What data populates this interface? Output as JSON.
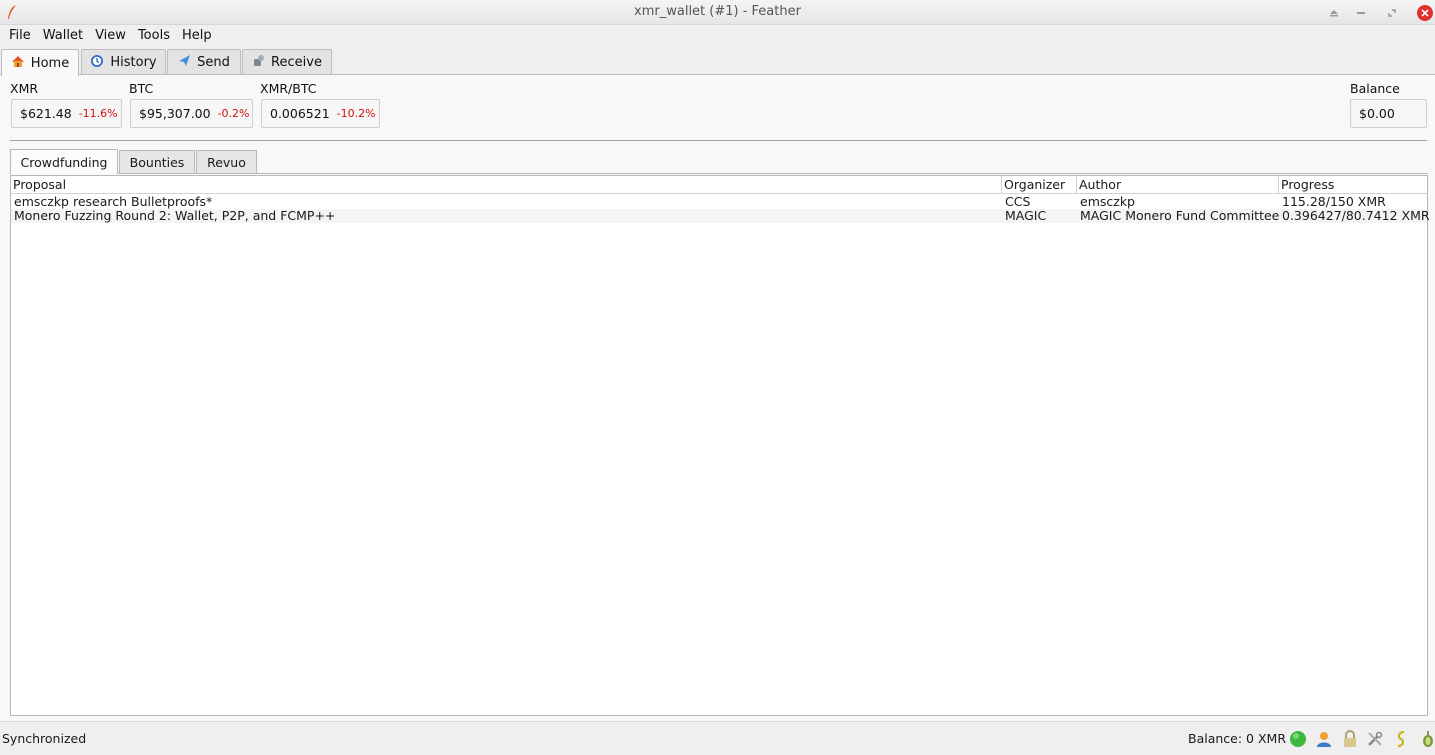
{
  "window": {
    "title": "xmr_wallet (#1) - Feather"
  },
  "menu": [
    "File",
    "Wallet",
    "View",
    "Tools",
    "Help"
  ],
  "tabs": [
    {
      "label": "Home",
      "icon": "home-icon"
    },
    {
      "label": "History",
      "icon": "history-icon"
    },
    {
      "label": "Send",
      "icon": "send-icon"
    },
    {
      "label": "Receive",
      "icon": "receive-icon"
    }
  ],
  "tickers": {
    "xmr": {
      "label": "XMR",
      "value": "$621.48",
      "change": "-11.6%"
    },
    "btc": {
      "label": "BTC",
      "value": "$95,307.00",
      "change": "-0.2%"
    },
    "xmrbtc": {
      "label": "XMR/BTC",
      "value": "0.006521",
      "change": "-10.2%"
    },
    "balance": {
      "label": "Balance",
      "value": "$0.00"
    }
  },
  "subtabs": [
    "Crowdfunding",
    "Bounties",
    "Revuo"
  ],
  "table": {
    "columns": [
      "Proposal",
      "Organizer",
      "Author",
      "Progress"
    ],
    "rows": [
      [
        "emsczkp research Bulletproofs*",
        "CCS",
        "emsczkp",
        "115.28/150 XMR"
      ],
      [
        "Monero Fuzzing Round 2: Wallet, P2P, and FCMP++",
        "MAGIC",
        "MAGIC Monero Fund Committee",
        "0.396427/80.7412 XMR"
      ]
    ]
  },
  "status": {
    "text": "Synchronized",
    "balance": "Balance: 0 XMR",
    "icons": [
      "connection-status-icon",
      "contacts-icon",
      "lock-icon",
      "settings-icon",
      "seed-icon",
      "tor-icon"
    ]
  },
  "colors": {
    "negative_change": "#d01010",
    "connected": "#3cb83c"
  }
}
